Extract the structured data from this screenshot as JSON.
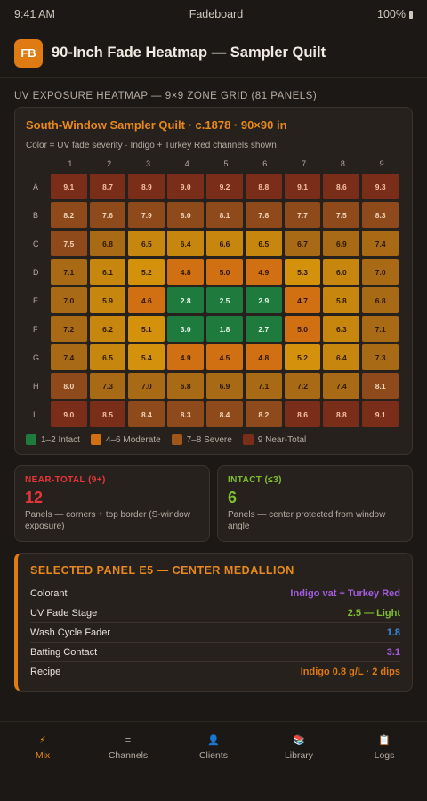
{
  "status": {
    "time": "9:41 AM",
    "app": "Fadeboard",
    "battery": "100%"
  },
  "header": {
    "logo": "FB",
    "title": "90-Inch Fade Heatmap — Sampler Quilt"
  },
  "section_title": "UV EXPOSURE HEATMAP — 9×9 ZONE GRID (81 PANELS)",
  "heatmap": {
    "title": "South-Window Sampler Quilt · c.1878 · 90×90 in",
    "subtitle": "Color = UV fade severity · Indigo + Turkey Red channels shown",
    "columns": [
      "1",
      "2",
      "3",
      "4",
      "5",
      "6",
      "7",
      "8",
      "9"
    ],
    "rows": [
      {
        "label": "A",
        "values": [
          "9.1",
          "8.7",
          "8.9",
          "9.0",
          "9.2",
          "8.8",
          "9.1",
          "8.6",
          "9.3"
        ]
      },
      {
        "label": "B",
        "values": [
          "8.2",
          "7.6",
          "7.9",
          "8.0",
          "8.1",
          "7.8",
          "7.7",
          "7.5",
          "8.3"
        ]
      },
      {
        "label": "C",
        "values": [
          "7.5",
          "6.8",
          "6.5",
          "6.4",
          "6.6",
          "6.5",
          "6.7",
          "6.9",
          "7.4"
        ]
      },
      {
        "label": "D",
        "values": [
          "7.1",
          "6.1",
          "5.2",
          "4.8",
          "5.0",
          "4.9",
          "5.3",
          "6.0",
          "7.0"
        ]
      },
      {
        "label": "E",
        "values": [
          "7.0",
          "5.9",
          "4.6",
          "2.8",
          "2.5",
          "2.9",
          "4.7",
          "5.8",
          "6.8"
        ]
      },
      {
        "label": "F",
        "values": [
          "7.2",
          "6.2",
          "5.1",
          "3.0",
          "1.8",
          "2.7",
          "5.0",
          "6.3",
          "7.1"
        ]
      },
      {
        "label": "G",
        "values": [
          "7.4",
          "6.5",
          "5.4",
          "4.9",
          "4.5",
          "4.8",
          "5.2",
          "6.4",
          "7.3"
        ]
      },
      {
        "label": "H",
        "values": [
          "8.0",
          "7.3",
          "7.0",
          "6.8",
          "6.9",
          "7.1",
          "7.2",
          "7.4",
          "8.1"
        ]
      },
      {
        "label": "I",
        "values": [
          "9.0",
          "8.5",
          "8.4",
          "8.3",
          "8.4",
          "8.2",
          "8.6",
          "8.8",
          "9.1"
        ]
      }
    ],
    "legend": [
      {
        "label": "1–2 Intact",
        "color": "#1f7a3e"
      },
      {
        "label": "4–6 Moderate",
        "color": "#d07012"
      },
      {
        "label": "7–8 Severe",
        "color": "#a0551a"
      },
      {
        "label": "9 Near-Total",
        "color": "#7a2d18"
      }
    ]
  },
  "stats": {
    "near_total": {
      "label": "NEAR-TOTAL (9+)",
      "value": "12",
      "desc": "Panels — corners + top border (S-window exposure)"
    },
    "intact": {
      "label": "INTACT (≤3)",
      "value": "6",
      "desc": "Panels — center protected from window angle"
    }
  },
  "detail": {
    "title": "SELECTED PANEL E5 — CENTER MEDALLION",
    "rows": [
      {
        "key": "Colorant",
        "value": "Indigo vat + Turkey Red",
        "color": "purple"
      },
      {
        "key": "UV Fade Stage",
        "value": "2.5 — Light",
        "color": "green"
      },
      {
        "key": "Wash Cycle Fader",
        "value": "1.8",
        "color": "blue"
      },
      {
        "key": "Batting Contact",
        "value": "3.1",
        "color": "purple"
      },
      {
        "key": "Recipe",
        "value": "Indigo 0.8 g/L · 2 dips",
        "color": "orange"
      }
    ]
  },
  "tabs": [
    {
      "label": "Mix",
      "icon": "⚡",
      "icon_name": "lightning-icon",
      "active": true
    },
    {
      "label": "Channels",
      "icon": "≡",
      "icon_name": "menu-icon",
      "active": false
    },
    {
      "label": "Clients",
      "icon": "👤",
      "icon_name": "user-icon",
      "active": false
    },
    {
      "label": "Library",
      "icon": "📚",
      "icon_name": "books-icon",
      "active": false
    },
    {
      "label": "Logs",
      "icon": "📋",
      "icon_name": "clipboard-icon",
      "active": false
    }
  ]
}
